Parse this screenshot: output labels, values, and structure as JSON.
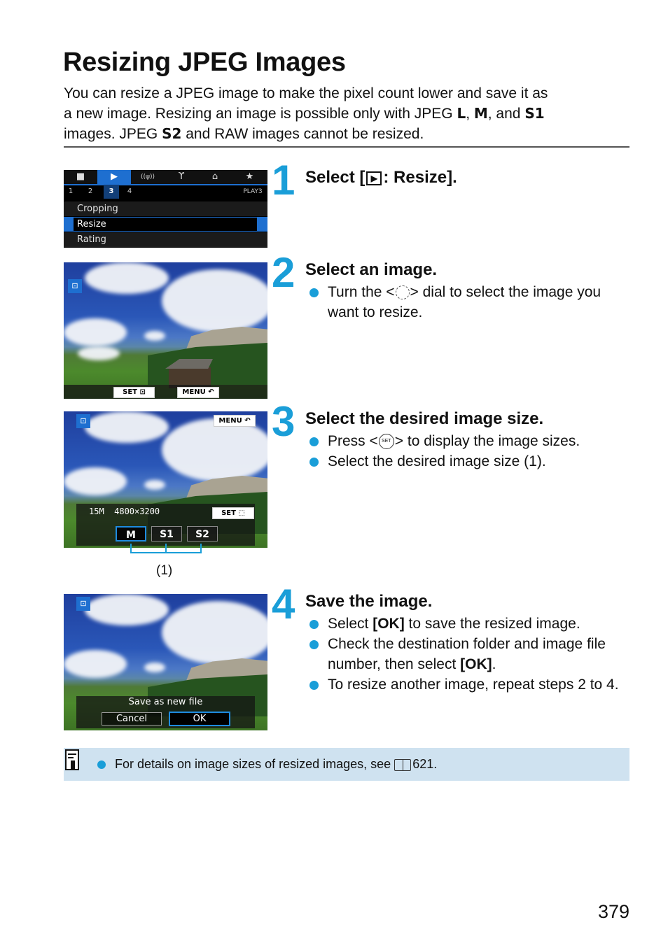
{
  "page": {
    "title": "Resizing JPEG Images",
    "intro": {
      "line1": "You can resize a JPEG image to make the pixel count lower and save it as",
      "line2_a": "a new image. Resizing an image is possible only with JPEG ",
      "sym_L": "L",
      "sep1": ", ",
      "sym_M": "M",
      "line2_b": ", and ",
      "sym_S1": "S1",
      "line3_a": "images. JPEG ",
      "sym_S2": "S2",
      "line3_b": " and RAW images cannot be resized."
    },
    "page_number": "379"
  },
  "steps": [
    {
      "number": "1",
      "heading_a": "Select [",
      "heading_b": ": Resize].",
      "heading_icon": "playback-icon"
    },
    {
      "number": "2",
      "heading": "Select an image.",
      "bullets": [
        {
          "a": "Turn the <",
          "icon": "quick-control-dial-icon",
          "b": "> dial to select the image you want to resize."
        }
      ]
    },
    {
      "number": "3",
      "heading": "Select the desired image size.",
      "bullets": [
        {
          "a": "Press <",
          "icon": "set-button-icon",
          "b": "> to display the image sizes."
        },
        {
          "text": "Select the desired image size (1)."
        }
      ],
      "callout": "(1)"
    },
    {
      "number": "4",
      "heading": "Save the image.",
      "bullets": [
        {
          "a": "Select ",
          "bold": "[OK]",
          "b": " to save the resized image."
        },
        {
          "a": "Check the destination folder and image file number, then select ",
          "bold": "[OK]",
          "b": "."
        },
        {
          "text": "To resize another image, repeat steps 2 to 4."
        }
      ]
    }
  ],
  "screens": {
    "menu": {
      "tabs": [
        "camera-icon",
        "playback-icon",
        "wireless-icon",
        "wrench-icon",
        "custom-function-icon",
        "star-icon"
      ],
      "tab_glyphs": [
        "■",
        "▶",
        "((ψ))",
        "ϒ",
        "⌂",
        "★"
      ],
      "active_tab": 1,
      "sub_tabs": [
        "1",
        "2",
        "3",
        "4"
      ],
      "active_sub_tab": 2,
      "page_label": "PLAY3",
      "items": [
        "Cropping",
        "Resize",
        "Rating"
      ],
      "selected_item": 1
    },
    "select_image": {
      "set_label": "SET",
      "menu_label": "MENU",
      "back_glyph": "↶"
    },
    "size_select": {
      "menu_label": "MENU",
      "back_glyph": "↶",
      "info": "15M  4800×3200",
      "set_label": "SET",
      "sizes": [
        "M",
        "S1",
        "S2"
      ],
      "selected_size": 0
    },
    "save": {
      "prompt": "Save as new file",
      "cancel": "Cancel",
      "ok": "OK",
      "selected": "OK"
    }
  },
  "tip": {
    "text_a": "For details on image sizes of resized images, see ",
    "page_ref": "621",
    "text_b": "."
  },
  "colors": {
    "accent": "#1a9ed8",
    "tip_bg": "#cfe2f0",
    "camera_select": "#1e6fd0"
  }
}
